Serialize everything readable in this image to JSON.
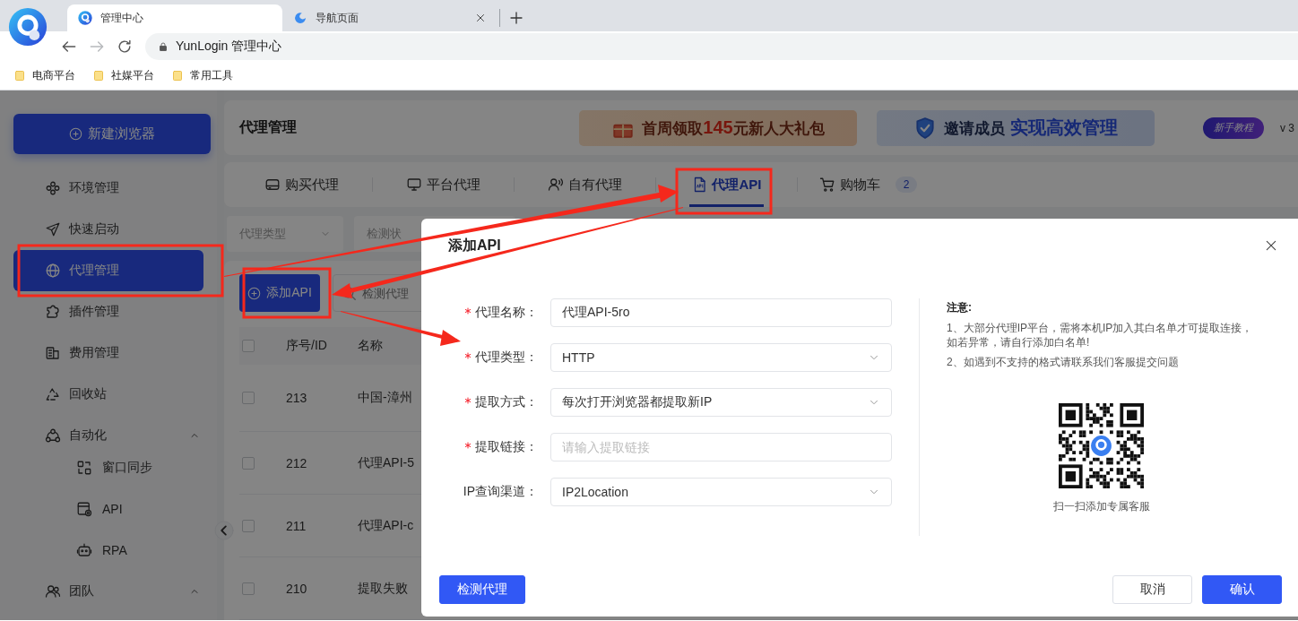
{
  "browser": {
    "tabs": [
      {
        "title": "管理中心",
        "selected": true,
        "closable": false
      },
      {
        "title": "导航页面",
        "selected": false,
        "closable": true
      }
    ],
    "address": "YunLogin 管理中心",
    "forward_disabled": true,
    "bookmarks": [
      "电商平台",
      "社媒平台",
      "常用工具"
    ]
  },
  "sidebar": {
    "new_button": "新建浏览器",
    "items": [
      {
        "label": "环境管理",
        "selected": false
      },
      {
        "label": "快速启动",
        "selected": false
      },
      {
        "label": "代理管理",
        "selected": true
      },
      {
        "label": "插件管理",
        "selected": false
      },
      {
        "label": "费用管理",
        "selected": false
      },
      {
        "label": "回收站",
        "selected": false
      },
      {
        "label": "自动化",
        "selected": false,
        "expanded": true,
        "children": [
          {
            "label": "窗口同步",
            "selected": false
          },
          {
            "label": "API",
            "selected": false
          },
          {
            "label": "RPA",
            "selected": false
          }
        ]
      },
      {
        "label": "团队",
        "selected": false,
        "expanded": true
      }
    ]
  },
  "header": {
    "title": "代理管理",
    "banners": [
      {
        "lead": "首周领取",
        "highlight": "145",
        "tail": "元新人大礼包"
      },
      {
        "lead": "邀请成员",
        "highlight": "实现高效管理"
      }
    ],
    "tutorial": "新手教程",
    "version": "v 3"
  },
  "tabs": [
    {
      "label": "购买代理",
      "selected": false
    },
    {
      "label": "平台代理",
      "selected": false
    },
    {
      "label": "自有代理",
      "selected": false
    },
    {
      "label": "代理API",
      "selected": true
    },
    {
      "label": "购物车",
      "selected": false,
      "count": "2"
    }
  ],
  "filters": [
    {
      "placeholder": "代理类型"
    },
    {
      "placeholder": "检测状"
    }
  ],
  "toolbar": {
    "add_button": "添加API",
    "search_placeholder": "检测代理"
  },
  "table": {
    "all_selected": false,
    "columns": [
      "序号/ID",
      "名称"
    ],
    "rows": [
      {
        "id": "213",
        "name": "中国-漳州",
        "selected": false
      },
      {
        "id": "212",
        "name": "代理API-5",
        "selected": false
      },
      {
        "id": "211",
        "name": "代理API-c",
        "selected": false
      },
      {
        "id": "210",
        "name": "提取失败",
        "selected": false
      }
    ]
  },
  "modal": {
    "title": "添加API",
    "fields": [
      {
        "label": "代理名称：",
        "required": true,
        "kind": "input",
        "value": "代理API-5ro"
      },
      {
        "label": "代理类型：",
        "required": true,
        "kind": "select",
        "value": "HTTP"
      },
      {
        "label": "提取方式：",
        "required": true,
        "kind": "select",
        "value": "每次打开浏览器都提取新IP"
      },
      {
        "label": "提取链接：",
        "required": true,
        "kind": "input",
        "placeholder": "请输入提取链接"
      },
      {
        "label": "IP查询渠道：",
        "required": false,
        "kind": "select",
        "value": "IP2Location"
      }
    ],
    "notice": {
      "title": "注意:",
      "items": [
        "1、大部分代理IP平台，需将本机IP加入其白名单才可提取连接，如若异常，请自行添加白名单!",
        "2、如遇到不支持的格式请联系我们客服提交问题"
      ]
    },
    "qr_caption": "扫一扫添加专属客服",
    "buttons": [
      {
        "label": "检测代理",
        "kind": "primary"
      },
      {
        "label": "取消",
        "kind": "default"
      },
      {
        "label": "确认",
        "kind": "primary"
      }
    ]
  }
}
